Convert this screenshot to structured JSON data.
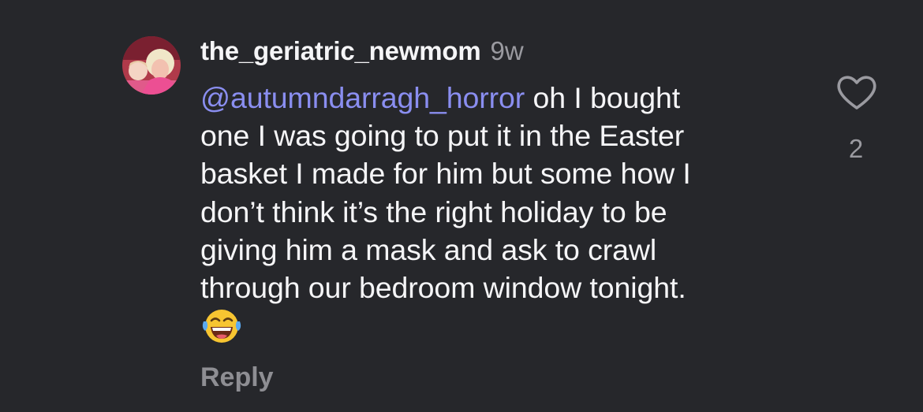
{
  "comment": {
    "username": "the_geriatric_newmom",
    "timestamp": "9w",
    "mention": "@autumndarragh_horror",
    "lines": [
      " oh I bought",
      "one I was going to put it in the Easter",
      "basket I made for him but some how I",
      "don’t think it’s the right holiday to be",
      "giving him a mask and ask to crawl",
      "through our bedroom window tonight."
    ],
    "emoji": "face-with-tears-of-joy",
    "reply_label": "Reply",
    "like_count": "2",
    "like_icon": "heart-outline-icon"
  },
  "colors": {
    "background": "#26272b",
    "mention": "#8a8ef0",
    "text": "#f5f5f7",
    "secondary": "#9a9aa0"
  }
}
